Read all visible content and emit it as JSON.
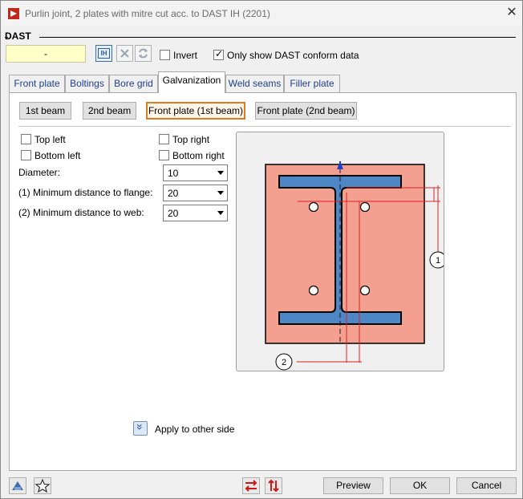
{
  "window": {
    "title": "Purlin joint, 2 plates with mitre cut acc. to DAST IH (2201)",
    "close_glyph": "✕"
  },
  "dast": {
    "group_label": "DAST",
    "field_value": "-",
    "ih_label": "IH",
    "invert_label": "Invert",
    "invert_checked": false,
    "conform_label": "Only show DAST conform data",
    "conform_checked": true
  },
  "tabs": [
    "Front plate",
    "Boltings",
    "Bore grid",
    "Galvanization",
    "Weld seams",
    "Filler plate"
  ],
  "active_tab": "Galvanization",
  "subbuttons": [
    "1st beam",
    "2nd beam",
    "Front plate (1st beam)",
    "Front plate (2nd beam)"
  ],
  "active_subbutton": "Front plate (1st beam)",
  "options": {
    "top_left": "Top left",
    "top_right": "Top right",
    "bottom_left": "Bottom left",
    "bottom_right": "Bottom right"
  },
  "fields": {
    "diameter_label": "Diameter:",
    "diameter_value": "10",
    "min_flange_label": "(1) Minimum distance to flange:",
    "min_flange_value": "20",
    "min_web_label": "(2) Minimum distance to web:",
    "min_web_value": "20"
  },
  "diagram": {
    "label_1": "1",
    "label_2": "2",
    "plate_color": "#f4a090",
    "beam_color": "#4f86c6",
    "dim_color": "#e02020"
  },
  "apply_label": "Apply to other side",
  "footer": {
    "preview": "Preview",
    "ok": "OK",
    "cancel": "Cancel"
  },
  "icons": [
    "app-icon",
    "help-icon",
    "star-icon",
    "swap-horizontal-icon",
    "swap-vertical-icon"
  ]
}
